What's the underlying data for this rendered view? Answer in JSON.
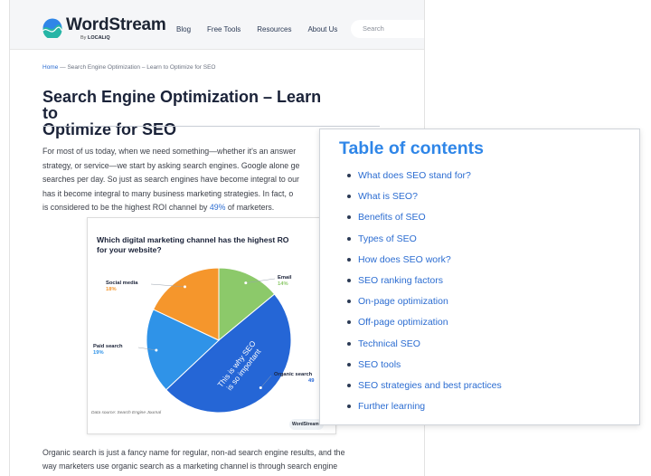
{
  "site": {
    "brand": "WordStream",
    "by_prefix": "By",
    "by_name": "LOCALiQ",
    "nav": [
      "Blog",
      "Free Tools",
      "Resources",
      "About Us"
    ],
    "search_placeholder": "Search"
  },
  "breadcrumb": {
    "home": "Home",
    "separator": "—",
    "current": "Search Engine Optimization – Learn to Optimize for SEO"
  },
  "article": {
    "title_line1": "Search Engine Optimization – Learn to",
    "title_line2": "Optimize for SEO",
    "intro_lines": [
      "For most of us today, when we need something—whether it's an answer",
      "strategy, or service—we start by asking search engines. Google alone ge",
      "searches per day. So just as search engines have become integral to our",
      "has it become integral to many business marketing strategies. In fact, o"
    ],
    "intro_last_prefix": "is considered to be the highest ROI channel by ",
    "intro_last_pct": "49%",
    "intro_last_suffix": " of marketers.",
    "outro_line1": "Organic search is just a fancy name for regular, non-ad search engine results, and the",
    "outro_line2": "way marketers use organic search as a marketing channel is through search engine"
  },
  "chart_data": {
    "type": "pie",
    "title_line1": "Which digital marketing channel has the highest RO",
    "title_line2": "for your website?",
    "slices": [
      {
        "label": "Email",
        "value": 14,
        "value_label": "14%",
        "color": "#8cc96a"
      },
      {
        "label": "Organic search",
        "value": 49,
        "value_label": "49",
        "color": "#2566d6"
      },
      {
        "label": "Paid search",
        "value": 19,
        "value_label": "19%",
        "color": "#2f93e8"
      },
      {
        "label": "Social media",
        "value": 18,
        "value_label": "18%",
        "color": "#f5962c"
      }
    ],
    "callout": [
      "This is why SEO",
      "is so important"
    ],
    "source": "Data source: Search Engine Journal",
    "watermark": "WordStream"
  },
  "toc": {
    "title": "Table of contents",
    "items": [
      "What does SEO stand for?",
      "What is SEO?",
      "Benefits of SEO",
      "Types of SEO",
      "How does SEO work?",
      "SEO ranking factors",
      "On-page optimization",
      "Off-page optimization",
      "Technical SEO",
      "SEO tools",
      "SEO strategies and best practices",
      "Further learning"
    ]
  },
  "colors": {
    "accent": "#2f86e8",
    "link": "#2b6cd1",
    "heading": "#1a2238"
  }
}
